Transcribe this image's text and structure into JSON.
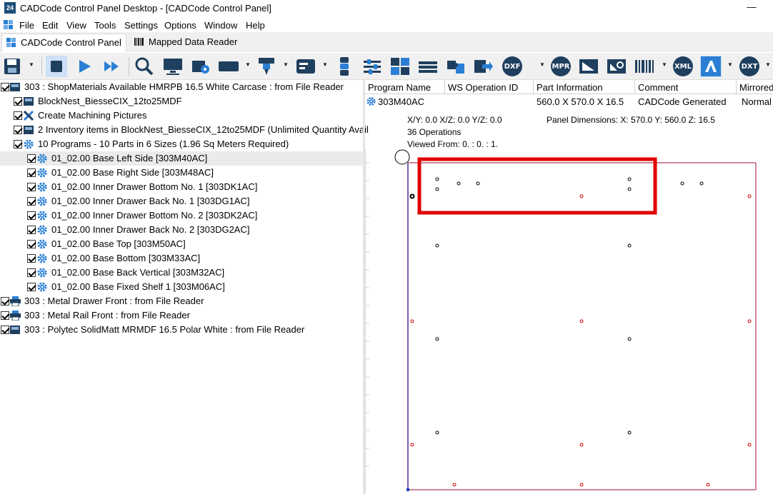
{
  "window": {
    "title": "CADCode Control Panel Desktop - [CADCode Control Panel]",
    "app_icon": "24",
    "minimize_glyph": "—"
  },
  "menu": {
    "items": [
      "File",
      "Edit",
      "View",
      "Tools",
      "Settings",
      "Options",
      "Window",
      "Help"
    ]
  },
  "tabs": [
    {
      "label": "CADCode Control Panel",
      "active": true
    },
    {
      "label": "Mapped Data Reader",
      "active": false
    }
  ],
  "toolbar": {
    "dxf": "DXF",
    "mpr": "MPR",
    "xml": "XML",
    "dxt": "DXT"
  },
  "tree": {
    "rows": [
      {
        "label": "303 : ShopMaterials Available HMRPB 16.5 White Carcase : from File Reader",
        "icon": "sheet-icon"
      },
      {
        "label": "BlockNest_BiesseCIX_12to25MDF",
        "icon": "sheet-icon"
      },
      {
        "label": "Create Machining Pictures",
        "icon": "tools-icon"
      },
      {
        "label": "2 Inventory items in BlockNest_BiesseCIX_12to25MDF (Unlimited Quantity Avail",
        "icon": "sheet-icon"
      },
      {
        "label": "10 Programs - 10 Parts in 6 Sizes (1.96 Sq Meters Required)",
        "icon": "gear-icon"
      },
      {
        "label": "01_02.00 Base Left Side [303M40AC]",
        "icon": "gear-icon"
      },
      {
        "label": "01_02.00 Base Right Side [303M48AC]",
        "icon": "gear-icon"
      },
      {
        "label": "01_02.00 Inner Drawer Bottom No. 1 [303DK1AC]",
        "icon": "gear-icon"
      },
      {
        "label": "01_02.00 Inner Drawer Back No. 1 [303DG1AC]",
        "icon": "gear-icon"
      },
      {
        "label": "01_02.00 Inner Drawer Bottom No. 2 [303DK2AC]",
        "icon": "gear-icon"
      },
      {
        "label": "01_02.00 Inner Drawer Back No. 2 [303DG2AC]",
        "icon": "gear-icon"
      },
      {
        "label": "01_02.00 Base Top [303M50AC]",
        "icon": "gear-icon"
      },
      {
        "label": "01_02.00 Base Bottom [303M33AC]",
        "icon": "gear-icon"
      },
      {
        "label": "01_02.00 Base Back Vertical [303M32AC]",
        "icon": "gear-icon"
      },
      {
        "label": "01_02.00 Base Fixed Shelf 1 [303M06AC]",
        "icon": "gear-icon"
      },
      {
        "label": "303 : Metal Drawer Front : from File Reader",
        "icon": "printer-icon"
      },
      {
        "label": "303 : Metal Rail Front : from File Reader",
        "icon": "printer-icon"
      },
      {
        "label": "303 : Polytec SolidMatt MRMDF 16.5 Polar White : from File Reader",
        "icon": "sheet-icon"
      }
    ]
  },
  "grid": {
    "columns": [
      "Program Name",
      "WS Operation ID",
      "Part Information",
      "Comment",
      "Mirrored"
    ],
    "row": {
      "program_name": "303M40AC",
      "ws_operation_id": "",
      "part_information": "560.0 X 570.0 X 16.5",
      "comment": "CADCode Generated",
      "mirrored": "Normal"
    }
  },
  "info": {
    "angles": "X/Y:  0.0 X/Z:  0.0 Y/Z:  0.0",
    "panel_dimensions": "Panel Dimensions: X: 570.0 Y: 560.0 Z: 16.5",
    "operations": "36 Operations",
    "viewed_from": "Viewed From: 0. : 0. : 1."
  },
  "colors": {
    "panel_outline": "#a01030",
    "highlight_box": "#e00000",
    "hole_black": "#000000",
    "hole_red": "#cc0000",
    "accent_blue": "#2a7fd4"
  }
}
